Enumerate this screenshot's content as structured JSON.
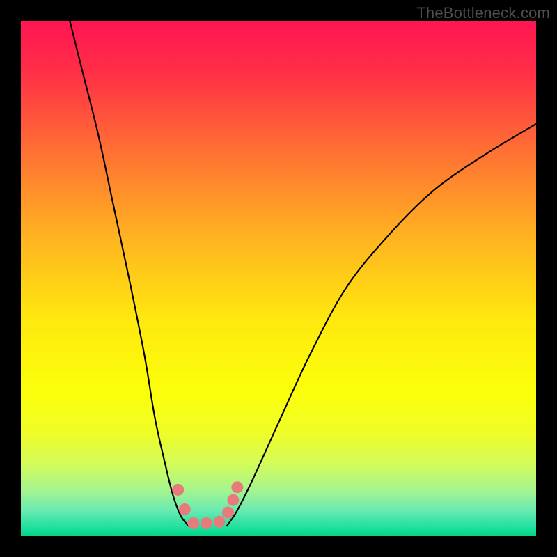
{
  "watermark": "TheBottleneck.com",
  "chart_data": {
    "type": "line",
    "title": "",
    "xlabel": "",
    "ylabel": "",
    "xlim": [
      0,
      100
    ],
    "ylim": [
      0,
      100
    ],
    "series": [
      {
        "name": "curve-left",
        "x": [
          9.5,
          12,
          15,
          18,
          21,
          24,
          26,
          28,
          29.5,
          31,
          32.5
        ],
        "values": [
          100,
          90,
          78,
          64,
          50,
          35,
          23,
          14,
          8,
          4,
          2
        ]
      },
      {
        "name": "curve-right",
        "x": [
          40,
          42,
          45,
          50,
          56,
          63,
          71,
          80,
          90,
          100
        ],
        "values": [
          2,
          5,
          11,
          22,
          35,
          48,
          58,
          67,
          74,
          80
        ]
      }
    ],
    "markers": [
      {
        "x": 30.5,
        "y": 9.0
      },
      {
        "x": 31.8,
        "y": 5.2
      },
      {
        "x": 33.5,
        "y": 2.5
      },
      {
        "x": 36.0,
        "y": 2.5
      },
      {
        "x": 38.5,
        "y": 2.8
      },
      {
        "x": 40.2,
        "y": 4.6
      },
      {
        "x": 41.2,
        "y": 7.0
      },
      {
        "x": 42.0,
        "y": 9.5
      }
    ],
    "marker_color": "#e77b7b",
    "gradient_stops": [
      {
        "offset": 0.0,
        "color": "#ff1552"
      },
      {
        "offset": 0.1,
        "color": "#ff2f47"
      },
      {
        "offset": 0.25,
        "color": "#ff6f34"
      },
      {
        "offset": 0.42,
        "color": "#ffb321"
      },
      {
        "offset": 0.58,
        "color": "#ffe80f"
      },
      {
        "offset": 0.72,
        "color": "#fbff0a"
      },
      {
        "offset": 0.8,
        "color": "#effd28"
      },
      {
        "offset": 0.86,
        "color": "#d3fb5a"
      },
      {
        "offset": 0.91,
        "color": "#a6f58e"
      },
      {
        "offset": 0.95,
        "color": "#6aeab1"
      },
      {
        "offset": 0.985,
        "color": "#1bdf9e"
      },
      {
        "offset": 1.0,
        "color": "#05d57f"
      }
    ]
  }
}
